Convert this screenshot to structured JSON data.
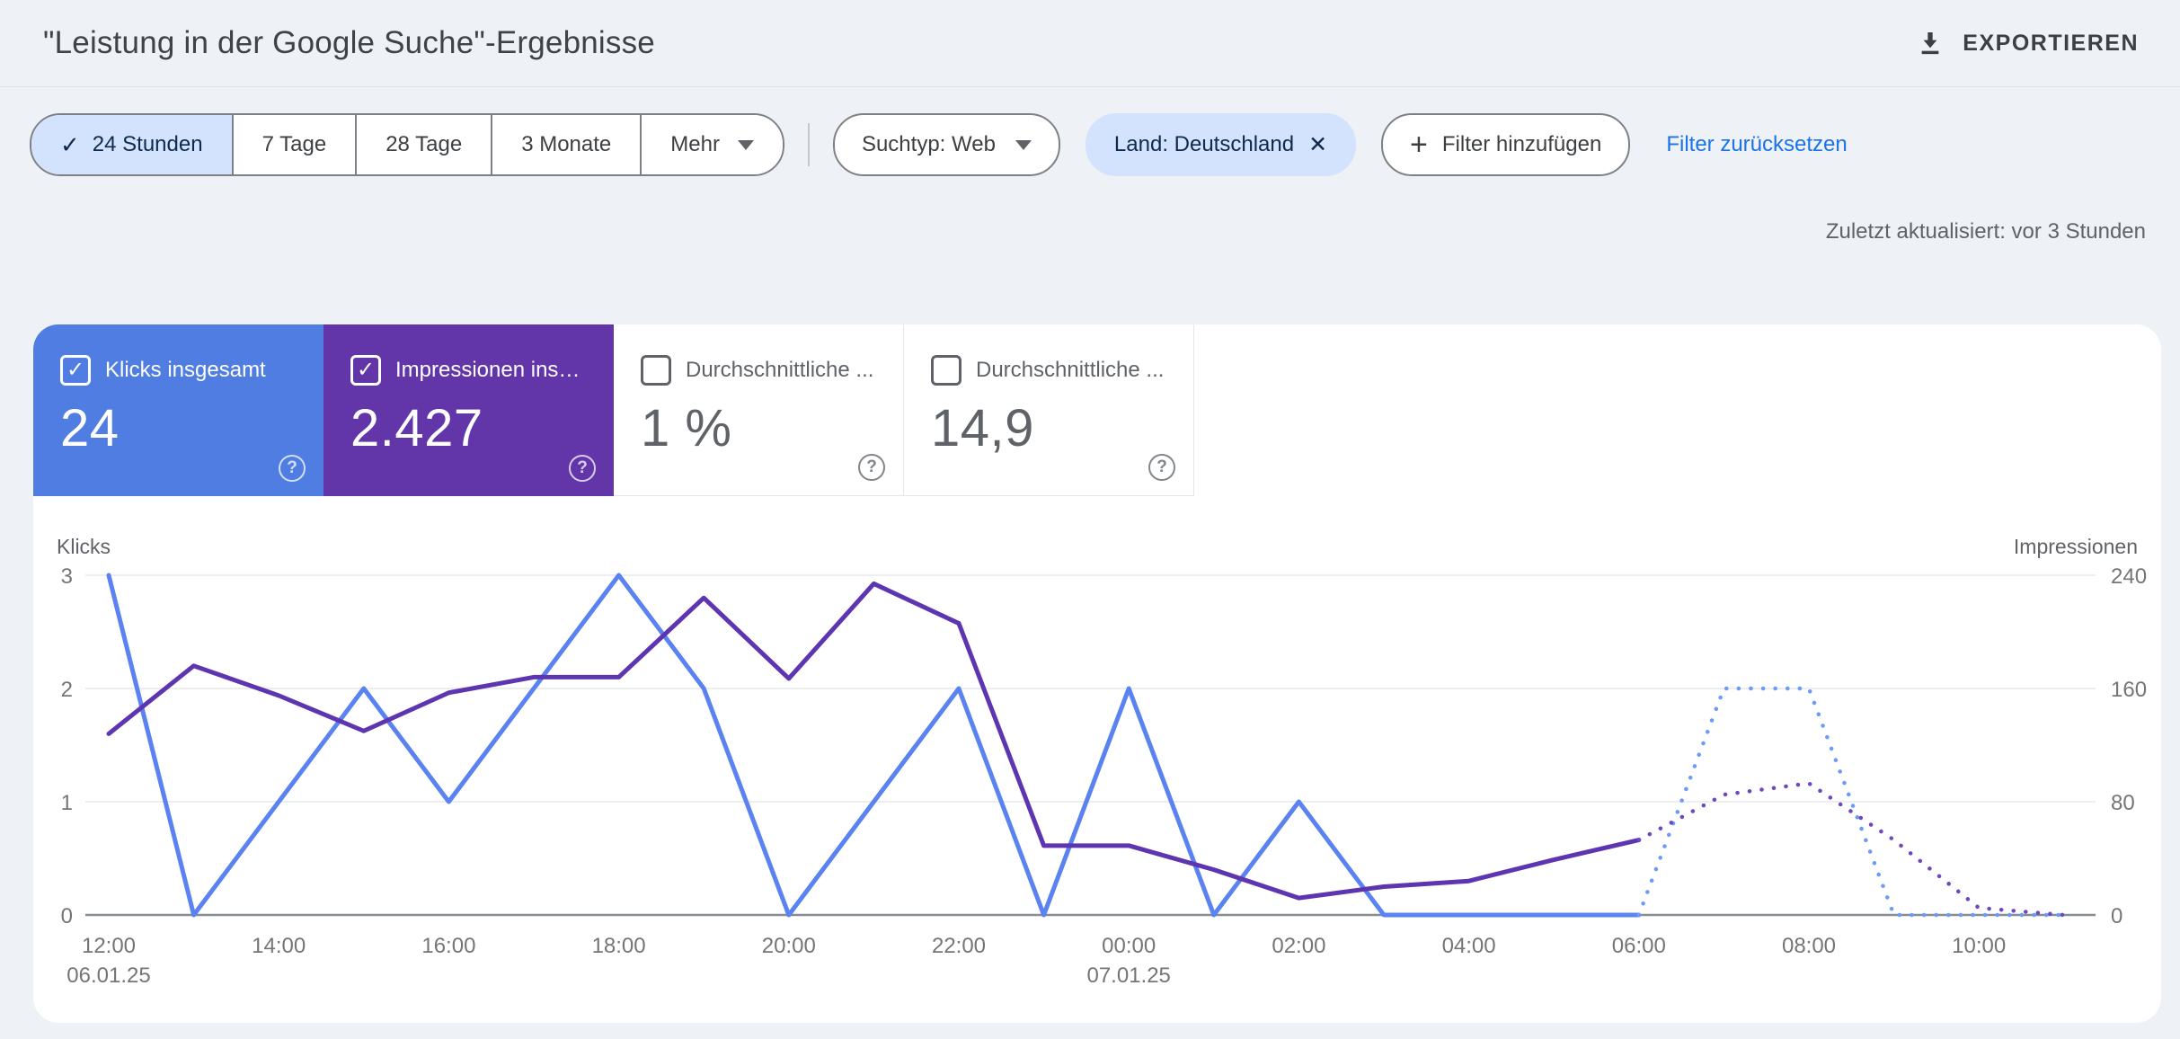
{
  "header": {
    "title": "\"Leistung in der Google Suche\"-Ergebnisse",
    "export_label": "EXPORTIEREN"
  },
  "filters": {
    "date_ranges": [
      {
        "label": "24 Stunden",
        "selected": true
      },
      {
        "label": "7 Tage",
        "selected": false
      },
      {
        "label": "28 Tage",
        "selected": false
      },
      {
        "label": "3 Monate",
        "selected": false
      },
      {
        "label": "Mehr",
        "selected": false,
        "has_caret": true
      }
    ],
    "search_type_chip": "Suchtyp: Web",
    "country_chip": "Land: Deutschland",
    "add_filter_label": "Filter hinzufügen",
    "reset_label": "Filter zurücksetzen",
    "last_updated": "Zuletzt aktualisiert: vor 3 Stunden"
  },
  "metric_cards": [
    {
      "label": "Klicks insgesamt",
      "value": "24",
      "checked": true,
      "bg": "#507de1"
    },
    {
      "label": "Impressionen ins…",
      "value": "2.427",
      "checked": true,
      "bg": "#6236a9"
    },
    {
      "label": "Durchschnittliche ...",
      "value": "1 %",
      "checked": false,
      "bg": null
    },
    {
      "label": "Durchschnittliche ...",
      "value": "14,9",
      "checked": false,
      "bg": null
    }
  ],
  "chart_data": {
    "type": "line",
    "x": [
      "12:00",
      "13:00",
      "14:00",
      "15:00",
      "16:00",
      "17:00",
      "18:00",
      "19:00",
      "20:00",
      "21:00",
      "22:00",
      "23:00",
      "00:00",
      "01:00",
      "02:00",
      "03:00",
      "04:00",
      "05:00",
      "06:00",
      "07:00",
      "08:00",
      "09:00",
      "10:00",
      "11:00"
    ],
    "x_ticks": [
      {
        "index": 0,
        "text": "12:00",
        "date": "06.01.25"
      },
      {
        "index": 2,
        "text": "14:00",
        "date": ""
      },
      {
        "index": 4,
        "text": "16:00",
        "date": ""
      },
      {
        "index": 6,
        "text": "18:00",
        "date": ""
      },
      {
        "index": 8,
        "text": "20:00",
        "date": ""
      },
      {
        "index": 10,
        "text": "22:00",
        "date": ""
      },
      {
        "index": 12,
        "text": "00:00",
        "date": "07.01.25"
      },
      {
        "index": 14,
        "text": "02:00",
        "date": ""
      },
      {
        "index": 16,
        "text": "04:00",
        "date": ""
      },
      {
        "index": 18,
        "text": "06:00",
        "date": ""
      },
      {
        "index": 20,
        "text": "08:00",
        "date": ""
      },
      {
        "index": 22,
        "text": "10:00",
        "date": ""
      }
    ],
    "left_axis": {
      "label": "Klicks",
      "ticks": [
        0,
        1,
        2,
        3
      ],
      "max": 3
    },
    "right_axis": {
      "label": "Impressionen",
      "ticks": [
        0,
        80,
        160,
        240
      ],
      "max": 240
    },
    "series": [
      {
        "name": "Klicks",
        "axis": "left",
        "color": "#5a82f0",
        "dotted_color": "#6b9bf7",
        "dotted_from_index": 18,
        "values": [
          3,
          0,
          1,
          2,
          1,
          2,
          3,
          2,
          0,
          1,
          2,
          0,
          2,
          0,
          1,
          0,
          0,
          0,
          0,
          2,
          2,
          0,
          0,
          0
        ]
      },
      {
        "name": "Impressionen",
        "axis": "right",
        "color": "#5e35b1",
        "dotted_color": "#6d48c0",
        "dotted_from_index": 18,
        "values": [
          128,
          176,
          155,
          130,
          157,
          168,
          168,
          224,
          167,
          234,
          206,
          49,
          49,
          32,
          12,
          20,
          24,
          39,
          53,
          85,
          93,
          53,
          5,
          0
        ]
      }
    ],
    "grid": true,
    "legend_position": "none"
  },
  "colors": {
    "clicks_accent": "#507de1",
    "impressions_accent": "#6236a9",
    "link_blue": "#1a73e8",
    "selected_chip_bg": "#d3e3fd",
    "page_background": "#eef1f5"
  }
}
